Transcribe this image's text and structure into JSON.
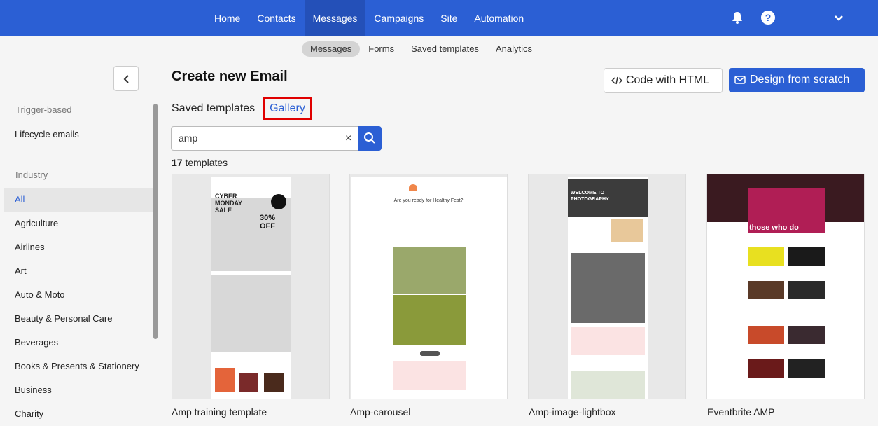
{
  "topnav": [
    "Home",
    "Contacts",
    "Messages",
    "Campaigns",
    "Site",
    "Automation"
  ],
  "topnav_active": "Messages",
  "help_label": "?",
  "subnav": [
    "Messages",
    "Forms",
    "Saved templates",
    "Analytics"
  ],
  "subnav_active": "Messages",
  "sidebar": {
    "trigger_heading": "Trigger-based",
    "trigger_items": [
      "Lifecycle emails"
    ],
    "industry_heading": "Industry",
    "industry_items": [
      "All",
      "Agriculture",
      "Airlines",
      "Art",
      "Auto & Moto",
      "Beauty & Personal Care",
      "Beverages",
      "Books & Presents & Stationery",
      "Business",
      "Charity"
    ],
    "active": "All"
  },
  "main": {
    "title": "Create new Email",
    "code_html_label": "Code with HTML",
    "design_label": "Design from scratch",
    "tab_saved": "Saved templates",
    "tab_gallery": "Gallery",
    "search_value": "amp",
    "clear_label": "×",
    "count_number": "17",
    "count_suffix": " templates"
  },
  "templates": [
    {
      "name": "Amp training template",
      "thumb_headline": "CYBER MONDAY SALE",
      "thumb_offer": "30% OFF"
    },
    {
      "name": "Amp-carousel",
      "thumb_headline": "Are you ready for Healthy Fest?"
    },
    {
      "name": "Amp-image-lightbox",
      "thumb_headline": "WELCOME TO PHOTOGRAPHY"
    },
    {
      "name": "Eventbrite AMP",
      "thumb_headline": "those who do"
    }
  ],
  "colors": {
    "brand": "#2b5fd4",
    "highlight": "#e00000"
  }
}
